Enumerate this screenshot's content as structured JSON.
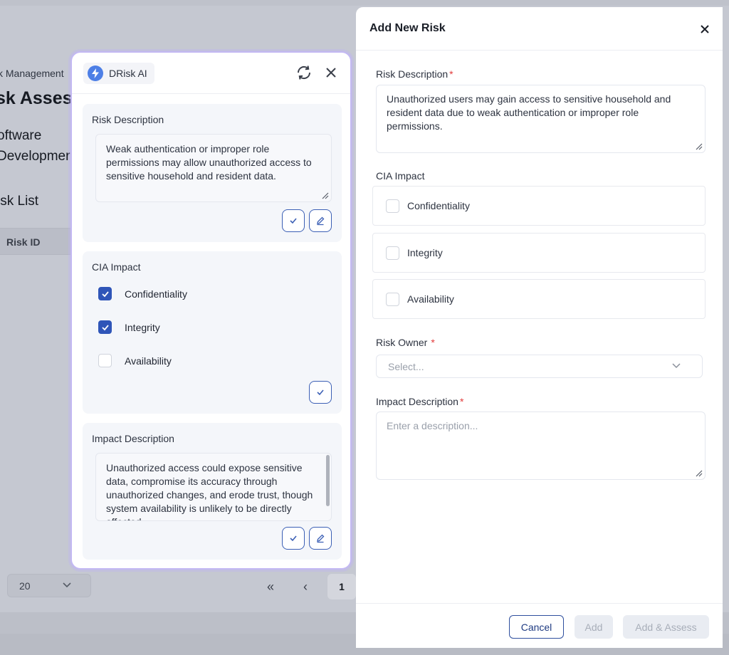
{
  "background": {
    "breadcrumb": "k Management",
    "page_title": "sk Asses",
    "project_name_line1": "oftware",
    "project_name_line2": "Developmer",
    "section_title": "isk List",
    "table_header_risk_id": "Risk ID",
    "page_size": "20",
    "pager_first": "«",
    "pager_prev": "‹",
    "pager_current": "1"
  },
  "ai_panel": {
    "brand_name": "DRisk AI",
    "brand_color": "#4d7fe6",
    "risk_description": {
      "title": "Risk Description",
      "text": "Weak authentication or improper role permissions may allow unauthorized access to sensitive household and resident data."
    },
    "cia_impact": {
      "title": "CIA Impact",
      "options": [
        {
          "label": "Confidentiality",
          "checked": true
        },
        {
          "label": "Integrity",
          "checked": true
        },
        {
          "label": "Availability",
          "checked": false
        }
      ]
    },
    "impact_description": {
      "title": "Impact Description",
      "text": "Unauthorized access could expose sensitive data, compromise its accuracy through unauthorized changes, and erode trust, though system availability is unlikely to be directly affected."
    }
  },
  "drawer": {
    "title": "Add New Risk",
    "risk_description": {
      "label": "Risk Description",
      "required_mark": "*",
      "value": "Unauthorized users may gain access to sensitive household and resident data due to weak authentication or improper role permissions."
    },
    "cia_impact": {
      "label": "CIA Impact",
      "options": [
        {
          "label": "Confidentiality",
          "checked": false
        },
        {
          "label": "Integrity",
          "checked": false
        },
        {
          "label": "Availability",
          "checked": false
        }
      ]
    },
    "risk_owner": {
      "label": "Risk Owner",
      "required_mark": "*",
      "placeholder": "Select..."
    },
    "impact_description": {
      "label": "Impact Description",
      "required_mark": "*",
      "placeholder": "Enter a description..."
    },
    "buttons": {
      "cancel": "Cancel",
      "add": "Add",
      "add_assess": "Add & Assess"
    }
  },
  "colors": {
    "accent": "#2f55b8",
    "required": "#e23b3b",
    "panel_border": "#c3b8f3"
  }
}
